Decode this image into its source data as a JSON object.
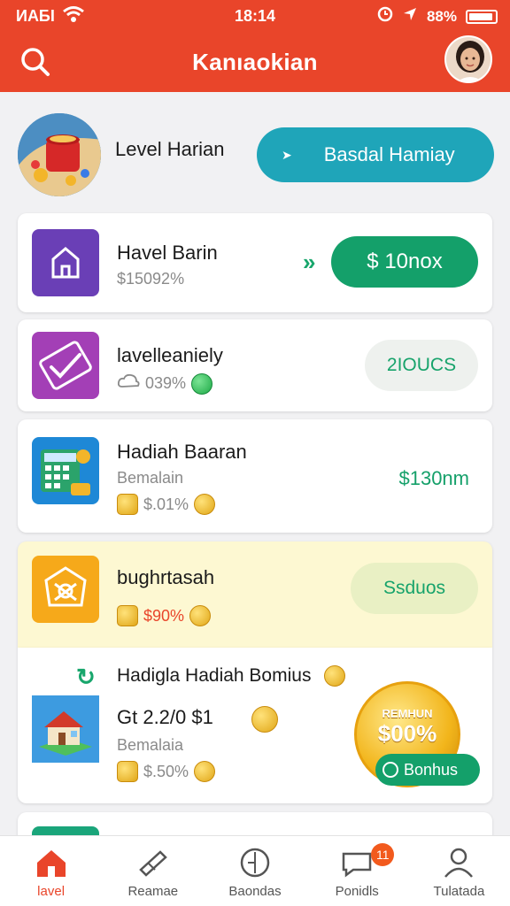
{
  "status_bar": {
    "carrier": "ИАБI",
    "time": "18:14",
    "battery": "88%"
  },
  "header": {
    "title": "Kanıaokian"
  },
  "level": {
    "label": "Level Harian",
    "button_label": "Basdal Hamiay"
  },
  "cards": [
    {
      "title": "Havel Barin",
      "subtitle": "$15092%",
      "button_label": "$ 10nox",
      "icon": "home-icon"
    },
    {
      "title": "lavelleaniely",
      "meta": "039%",
      "button_label": "2IOUCS",
      "icon": "check-icon"
    },
    {
      "title": "Hadiah Baaran",
      "subtitle": "Bemalain",
      "meta": "$.01%",
      "price": "$130nm",
      "icon": "calculator-icon"
    },
    {
      "title": "bughrtasah",
      "meta": "$90%",
      "button_label": "Ssduos",
      "icon": "star-badge-icon"
    },
    {
      "title": "Hadigla Hadiah Bomius",
      "line2": "Gt 2.2/0 $1",
      "subtitle": "Bemalaia",
      "meta": "$.50%",
      "icon": "house-icon",
      "badge_top": "REMHUN",
      "badge_value": "$00%",
      "bonus_label": "Bonhus"
    }
  ],
  "bottom_nav": [
    {
      "label": "lavel",
      "icon": "home-icon",
      "active": true
    },
    {
      "label": "Reamae",
      "icon": "ticket-icon",
      "active": false
    },
    {
      "label": "Baondas",
      "icon": "compass-icon",
      "active": false
    },
    {
      "label": "Ponidls",
      "icon": "chat-icon",
      "active": false,
      "badge": "11"
    },
    {
      "label": "Tulatada",
      "icon": "user-icon",
      "active": false
    }
  ],
  "colors": {
    "brand": "#e9452a",
    "accent_teal": "#1fa5b9",
    "accent_green": "#14a06a",
    "highlight": "#fdf8d2"
  }
}
